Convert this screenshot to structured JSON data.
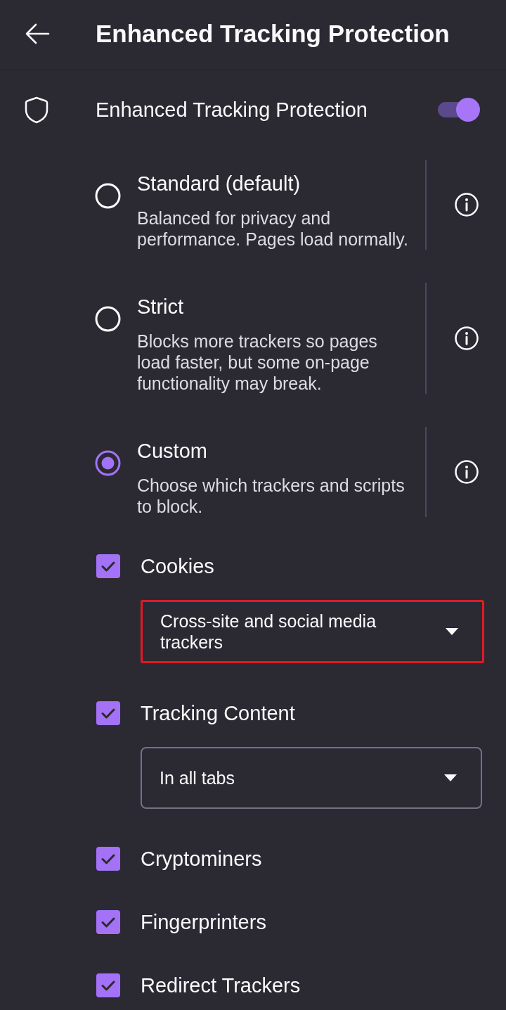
{
  "header": {
    "title": "Enhanced Tracking Protection"
  },
  "protection": {
    "label": "Enhanced Tracking Protection",
    "on": true
  },
  "modes": [
    {
      "title": "Standard (default)",
      "description": "Balanced for privacy and performance. Pages load normally.",
      "selected": false
    },
    {
      "title": "Strict",
      "description": "Blocks more trackers so pages load faster, but some on-page functionality may break.",
      "selected": false
    },
    {
      "title": "Custom",
      "description": "Choose which trackers and scripts to block.",
      "selected": true
    }
  ],
  "custom_options": [
    {
      "label": "Cookies",
      "checked": true,
      "dropdown": {
        "value": "Cross-site and social media trackers",
        "highlighted": true
      }
    },
    {
      "label": "Tracking Content",
      "checked": true,
      "dropdown": {
        "value": "In all tabs",
        "highlighted": false
      }
    },
    {
      "label": "Cryptominers",
      "checked": true
    },
    {
      "label": "Fingerprinters",
      "checked": true
    },
    {
      "label": "Redirect Trackers",
      "checked": true
    }
  ]
}
